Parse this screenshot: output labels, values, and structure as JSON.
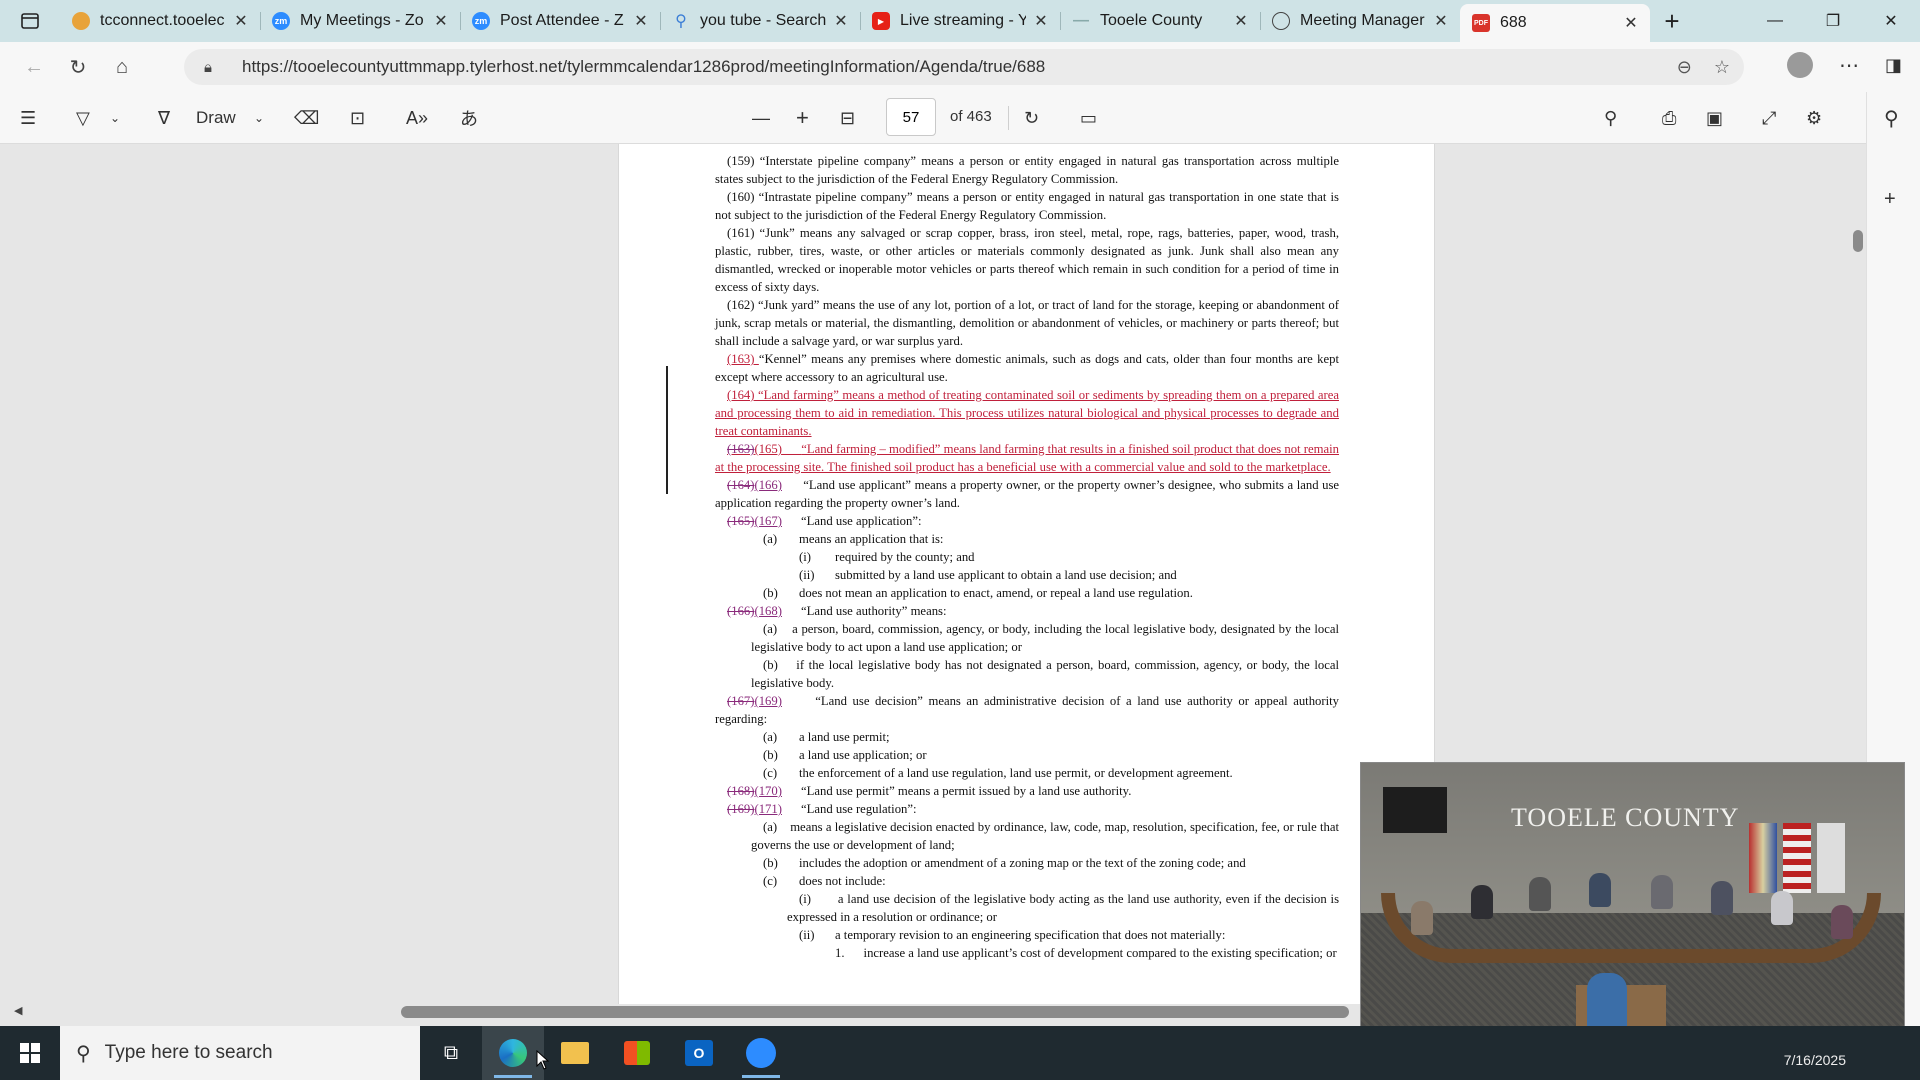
{
  "tabs": [
    {
      "title": "tcconnect.tooelec",
      "favicon": "pin-icon",
      "color": "#e8a33a"
    },
    {
      "title": "My Meetings - Zo",
      "favicon": "zoom-icon",
      "color": "#2d8cff"
    },
    {
      "title": "Post Attendee - Z",
      "favicon": "zoom-icon",
      "color": "#2d8cff"
    },
    {
      "title": "you tube - Search",
      "favicon": "search-icon",
      "color": "#3b7ed6"
    },
    {
      "title": "Live streaming - Y",
      "favicon": "youtube-icon",
      "color": "#e62117"
    },
    {
      "title": "Tooele County",
      "favicon": "dash-icon",
      "color": "#8aa"
    },
    {
      "title": "Meeting Manager",
      "favicon": "globe-icon",
      "color": "#555"
    },
    {
      "title": "688",
      "favicon": "pdf-icon",
      "color": "#d9342b",
      "active": true
    }
  ],
  "address": {
    "url": "https://tooelecountyuttmmapp.tylerhost.net/tylermmcalendar1286prod/meetingInformation/Agenda/true/688"
  },
  "pdf_toolbar": {
    "draw_label": "Draw",
    "page_current": "57",
    "page_total": "of 463"
  },
  "document": {
    "p159": "(159) “Interstate pipeline company” means a person or entity engaged in natural gas transportation across multiple states subject to the jurisdiction of the Federal Energy Regulatory Commission.",
    "p160": "(160) “Intrastate pipeline company” means a person or entity engaged in natural gas transportation in one state that is not subject to the jurisdiction of the Federal Energy Regulatory Commission.",
    "p161": "(161) “Junk” means any salvaged or scrap copper, brass, iron steel, metal, rope, rags, batteries, paper, wood, trash, plastic, rubber, tires, waste, or other articles or materials commonly designated as junk. Junk shall also mean any dismantled, wrecked or inoperable motor vehicles or parts thereof which remain in such condition for a period of time in excess of sixty days.",
    "p162": "(162) “Junk yard” means the use of any lot, portion of a lot, or tract of land for the storage, keeping or abandonment of junk, scrap metals or material, the dismantling, demolition or abandonment of vehicles, or machinery or parts thereof; but shall include a salvage yard, or war surplus yard.",
    "p163_num": "(163) ",
    "p163": "“Kennel” means any premises where domestic animals, such as dogs and cats, older than four months are kept except where accessory to an agricultural use.",
    "p164": "(164) “Land farming” means a method of treating contaminated soil or sediments by spreading them on a prepared area and processing them to aid in remediation. This process utilizes natural biological and physical processes to degrade and treat contaminants.",
    "p165_del": "(163)",
    "p165_num": "(165)",
    "p165": "“Land farming – modified” means land farming that results in a finished soil product that does not remain at the processing site. The finished soil product has a beneficial use with a commercial value and sold to the marketplace.",
    "p166_del": "(164)",
    "p166_num": "(166)",
    "p166": "“Land use applicant” means a property owner, or the property owner’s designee, who submits a land use application regarding the property owner’s land.",
    "p167_del": "(165)",
    "p167_num": "(167)",
    "p167": "“Land use application”:",
    "p167_a": "means an application that is:",
    "p167_a_i": "required by the county; and",
    "p167_a_ii": "submitted by a land use applicant to obtain a land use decision; and",
    "p167_b": "does not mean an application to enact, amend, or repeal a land use regulation.",
    "p168_del": "(166)",
    "p168_num": "(168)",
    "p168": "“Land use authority” means:",
    "p168_a": "a person, board, commission, agency, or body, including the local legislative body, designated by the local legislative body to act upon a land use application; or",
    "p168_b": "if the local legislative body has not designated a person, board, commission, agency, or body, the local legislative body.",
    "p169_del": "(167)",
    "p169_num": "(169)",
    "p169": "“Land use decision” means an administrative decision of a land use authority or appeal authority regarding:",
    "p169_a": "a land use permit;",
    "p169_b": "a land use application; or",
    "p169_c": "the enforcement of a land use regulation, land use permit, or development agreement.",
    "p170_del": "(168)",
    "p170_num": "(170)",
    "p170": "“Land use permit” means a permit issued by a land use authority.",
    "p171_del": "(169)",
    "p171_num": "(171)",
    "p171": "“Land use regulation”:",
    "p171_a": "means a legislative decision enacted by ordinance, law, code, map, resolution, specification, fee, or rule that governs the use or development of land;",
    "p171_b": "includes the adoption or amendment of a zoning map or the text of the zoning code; and",
    "p171_c": "does not include:",
    "p171_c_i": "a land use decision of the legislative body acting as the land use authority, even if the decision is expressed in a resolution or ordinance; or",
    "p171_c_ii": "a temporary revision to an engineering specification that does not materially:",
    "p171_c_ii_1": "increase a land use applicant’s cost of development compared to the existing specification; or",
    "label_a": "(a)",
    "label_b": "(b)",
    "label_c": "(c)",
    "label_i": "(i)",
    "label_ii": "(ii)",
    "label_1": "1."
  },
  "video": {
    "wall_text": "TOOELE COUNTY"
  },
  "taskbar": {
    "search_placeholder": "Type here to search",
    "clock_date": "7/16/2025"
  }
}
